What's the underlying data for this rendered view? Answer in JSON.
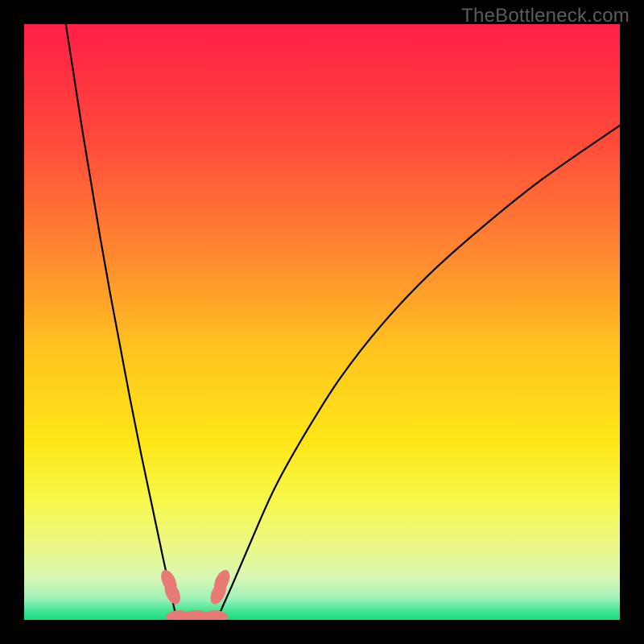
{
  "watermark": {
    "text": "TheBottleneck.com"
  },
  "chart_data": {
    "type": "line",
    "title": "",
    "xlabel": "",
    "ylabel": "",
    "xlim": [
      0,
      100
    ],
    "ylim": [
      0,
      100
    ],
    "grid": false,
    "legend": false,
    "annotations": [],
    "background_gradient_stops": [
      {
        "offset": 0.0,
        "color": "#ff1f47"
      },
      {
        "offset": 0.2,
        "color": "#ff4b3a"
      },
      {
        "offset": 0.4,
        "color": "#ff8d2f"
      },
      {
        "offset": 0.55,
        "color": "#ffc51f"
      },
      {
        "offset": 0.7,
        "color": "#ffe617"
      },
      {
        "offset": 0.8,
        "color": "#f6f84a"
      },
      {
        "offset": 0.88,
        "color": "#eaf88a"
      },
      {
        "offset": 0.93,
        "color": "#d7f7b4"
      },
      {
        "offset": 0.965,
        "color": "#9cf2b7"
      },
      {
        "offset": 0.985,
        "color": "#3fe692"
      },
      {
        "offset": 1.0,
        "color": "#18db80"
      }
    ],
    "series": [
      {
        "name": "left-branch",
        "x": [
          7.0,
          8.4,
          9.8,
          11.3,
          12.8,
          14.4,
          16.1,
          17.8,
          19.6,
          21.5,
          23.4,
          25.4,
          25.5
        ],
        "y": [
          100.0,
          91.0,
          82.0,
          73.0,
          64.0,
          55.0,
          46.0,
          37.0,
          28.0,
          19.0,
          10.0,
          1.0,
          0.0
        ]
      },
      {
        "name": "valley-floor",
        "x": [
          25.5,
          26.5,
          27.8,
          29.0,
          30.2,
          31.5,
          32.5
        ],
        "y": [
          0.0,
          0.0,
          0.0,
          0.0,
          0.0,
          0.0,
          0.0
        ]
      },
      {
        "name": "right-branch",
        "x": [
          32.5,
          33.0,
          35.0,
          38.0,
          42.0,
          47.0,
          53.0,
          60.0,
          68.0,
          77.0,
          87.0,
          100.0
        ],
        "y": [
          0.0,
          1.5,
          6.0,
          13.0,
          22.0,
          31.0,
          40.5,
          49.5,
          58.0,
          66.0,
          74.0,
          83.0
        ]
      }
    ],
    "markers": [
      {
        "name": "left-lobe-top-1",
        "x": 24.3,
        "y": 6.5,
        "rx": 1.1,
        "ry": 2.0,
        "rot": -25
      },
      {
        "name": "left-lobe-top-2",
        "x": 24.9,
        "y": 4.5,
        "rx": 1.1,
        "ry": 2.0,
        "rot": -25
      },
      {
        "name": "right-lobe-top-1",
        "x": 33.2,
        "y": 6.5,
        "rx": 1.1,
        "ry": 2.0,
        "rot": 25
      },
      {
        "name": "right-lobe-top-2",
        "x": 32.6,
        "y": 4.5,
        "rx": 1.1,
        "ry": 2.0,
        "rot": 25
      },
      {
        "name": "floor-lobe-left",
        "x": 26.0,
        "y": 0.5,
        "rx": 2.2,
        "ry": 1.1,
        "rot": 0
      },
      {
        "name": "floor-lobe-mid",
        "x": 29.0,
        "y": 0.5,
        "rx": 2.4,
        "ry": 1.1,
        "rot": 0
      },
      {
        "name": "floor-lobe-right",
        "x": 32.0,
        "y": 0.5,
        "rx": 2.2,
        "ry": 1.1,
        "rot": 0
      }
    ],
    "marker_color": "#e77a74",
    "curve_color": "#000000",
    "curve_width": 2.2
  }
}
